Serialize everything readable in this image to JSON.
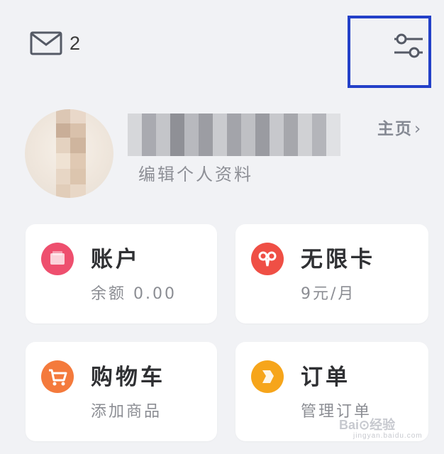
{
  "header": {
    "mail_count": "2"
  },
  "profile": {
    "edit_label": "编辑个人资料",
    "home_label": "主页",
    "home_chevron": "›"
  },
  "cards": {
    "account": {
      "title": "账户",
      "sub": "余额 0.00",
      "color": "#ee4f6e"
    },
    "unlimited": {
      "title": "无限卡",
      "sub": "9元/月",
      "color": "#ef4f45"
    },
    "cart": {
      "title": "购物车",
      "sub": "添加商品",
      "color": "#f47a3c"
    },
    "orders": {
      "title": "订单",
      "sub": "管理订单",
      "color": "#f6a51b"
    }
  },
  "watermark": {
    "brand": "Bai⊙经验",
    "url": "jingyan.baidu.com"
  },
  "icons": [
    "mail-icon",
    "settings-sliders-icon",
    "wallet-icon",
    "ribbon-icon",
    "cart-icon",
    "order-icon"
  ]
}
